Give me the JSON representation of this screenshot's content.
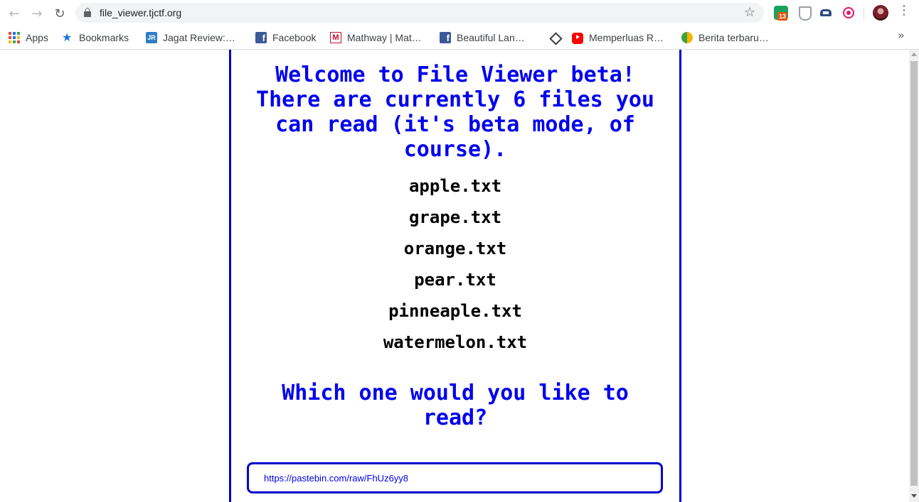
{
  "browser": {
    "url": "file_viewer.tjctf.org",
    "extension_badge": "13",
    "bookmarks": [
      {
        "label": "Apps",
        "icon": "apps-grid-icon"
      },
      {
        "label": "Bookmarks",
        "icon": "star-icon"
      },
      {
        "label": "Jagat Review:…",
        "icon": "jagat-review-icon"
      },
      {
        "label": "Facebook",
        "icon": "facebook-icon"
      },
      {
        "label": "Mathway | Mat…",
        "icon": "mathway-icon"
      },
      {
        "label": "Beautiful Lan…",
        "icon": "facebook-icon"
      },
      {
        "label": "",
        "icon": "diamond-icon"
      },
      {
        "label": "Memperluas R…",
        "icon": "youtube-icon"
      },
      {
        "label": "Berita terbaru…",
        "icon": "berita-icon"
      }
    ]
  },
  "page": {
    "welcome_heading": "Welcome to File Viewer beta! There are currently 6 files you can read (it's beta mode, of course).",
    "files": [
      "apple.txt",
      "grape.txt",
      "orange.txt",
      "pear.txt",
      "pinneaple.txt",
      "watermelon.txt"
    ],
    "question": "Which one would you like to read?",
    "input_value": "https://pastebin.com/raw/FhUz6yy8"
  },
  "colors": {
    "heading": "#0000ee",
    "panel_border": "#0000cc",
    "file_text": "#000000"
  }
}
